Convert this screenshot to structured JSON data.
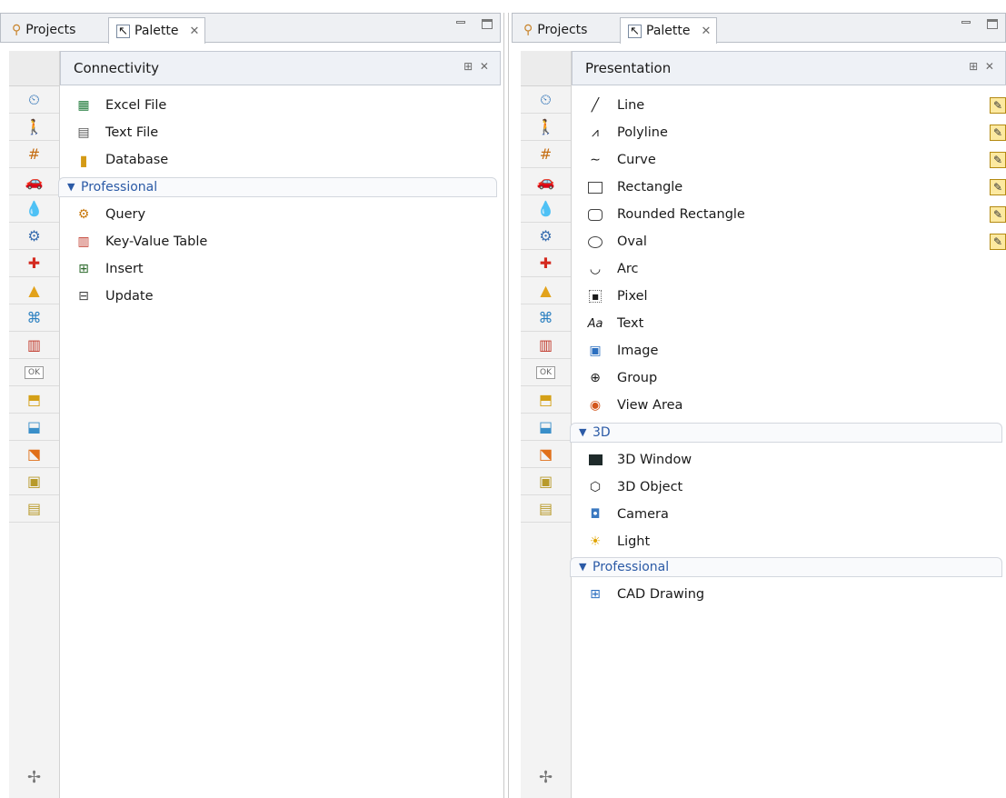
{
  "tabs": {
    "projects": "Projects",
    "palette": "Palette",
    "close": "✕"
  },
  "left": {
    "section_title": "Connectivity",
    "items": [
      "Excel File",
      "Text File",
      "Database"
    ],
    "group_label": "Professional",
    "pro_items": [
      "Query",
      "Key-Value Table",
      "Insert",
      "Update"
    ]
  },
  "right": {
    "section_title": "Presentation",
    "items": [
      "Line",
      "Polyline",
      "Curve",
      "Rectangle",
      "Rounded Rectangle",
      "Oval",
      "Arc",
      "Pixel",
      "Text",
      "Image",
      "Group",
      "View Area"
    ],
    "group_3d_label": "3D",
    "items_3d": [
      "3D Window",
      "3D Object",
      "Camera",
      "Light"
    ],
    "group_pro_label": "Professional",
    "pro_items": [
      "CAD Drawing"
    ]
  },
  "sidebar_icons": [
    "process-modeling-icon",
    "pedestrian-icon",
    "rail-library-icon",
    "road-traffic-icon",
    "fluid-icon",
    "process-library-icon",
    "ambulance-icon",
    "presentation-icon",
    "connectivity-icon",
    "analysis-icon",
    "controls-icon",
    "parameters-icon",
    "agent-icon",
    "actionchart-icon",
    "pictures-icon",
    "3d-objects-icon"
  ],
  "text_item_glyph": "Aa",
  "colors": {
    "group_label": "#2b5aa6",
    "tab_bg": "#eef0f3",
    "header_bg": "#eef1f6"
  }
}
